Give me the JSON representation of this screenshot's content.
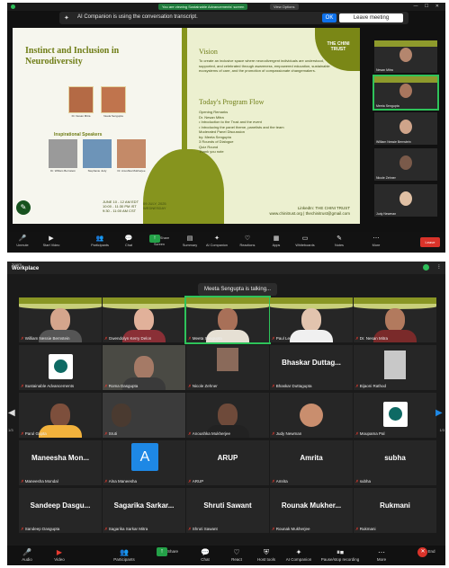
{
  "top": {
    "banner": "You are viewing Sustainable Advancements' screen",
    "view_options": "View Options",
    "ai_notice": "AI Companion is using the conversation transcript.",
    "ok": "OK",
    "leave_meeting": "Leave meeting",
    "slide": {
      "title_1": "Instinct and Inclusion in",
      "title_2": "Neurodiversity",
      "host1_cap": "Dr. Nesan Mitra",
      "host2_cap": "Neela Sengupta",
      "inspirational": "Inspirational Speakers",
      "sp1": "Dr. William Bernstein",
      "sp2": "Stephanie Judy",
      "sp3": "Dr. Anushka Mukherjee",
      "date_left": "JUNE 10 - 12 AM EDT\n10:00 - 11:30 PM IST\n9:30 - 11:00 AM CST",
      "date_right": "09 JULY, 2025\nWEDNESDAY",
      "logo": "THE CHINI TRUST",
      "vision_h": "Vision",
      "vision_p": "To create an inclusive space where neurodivergent individuals are understood, supported, and celebrated through awareness, empowered education, sustainable ecosystems of care, and the promotion of compassionate changemakers.",
      "flow_h": "Today's Program Flow",
      "flow_p": "Opening Remarks\nDr. Nesan Mitra\n• Introduction to the Trust and the event\n• Introducing the panel theme, panelists and the team\nModerated Panel Discussion\nby: Meeta Sengupta\n3 Rounds of Dialogue\nQuiz Round\nThank you note",
      "foot": "LinkedIn: THE CHINI TRUST\nwww.chinitrust.org | thechinitrust@gmail.com"
    },
    "strip": [
      {
        "name": "Nesan Mitra"
      },
      {
        "name": "Meeta Sengupta"
      },
      {
        "name": "William Nessie Bernstein"
      },
      {
        "name": "Nicole Zehner"
      },
      {
        "name": "Judy Newman"
      }
    ],
    "toolbar": [
      "Unmute",
      "Start Video",
      "Participants",
      "Chat",
      "Share Screen",
      "Summary",
      "AI Companion",
      "Reactions",
      "Apps",
      "Whiteboards",
      "Notes",
      "More"
    ],
    "leave": "Leave"
  },
  "bottom": {
    "brand_small": "zoom",
    "brand": "Workplace",
    "talking": "Meeta Sengupta is talking...",
    "page_prev": "1/3",
    "page_next": "1/3",
    "row1": [
      "William Nessie Bernstein",
      "Gwendolyn Kerry Delon",
      "Meeta Sengupta",
      "Paul Leary",
      "Dr. Nesan Mitra"
    ],
    "row2": [
      "Sustainable Advancements",
      "Roma Dasgupta",
      "Nicole Zehner",
      "Bhaskar Duttagupta",
      "Bijaoni Rathod"
    ],
    "row2_big": "Bhaskar Duttag...",
    "row3": [
      "Parul Gupta",
      "Sruti",
      "Anoushka Mukherjee",
      "Judy Newman",
      "Moupama Pal"
    ],
    "row4_big": [
      "Maneesha Mon...",
      "",
      "ARUP",
      "Amrita",
      "subha"
    ],
    "row4": [
      "Maneesha Mondal",
      "Alna Maneesha",
      "ARUP",
      "Amrita",
      "subha"
    ],
    "avatar_letter": "A",
    "row5_big": [
      "Sandeep Dasgu...",
      "Sagarika Sarkar...",
      "Shruti Sawant",
      "Rounak Mukher...",
      "Rukmani"
    ],
    "row5": [
      "Sandeep Dasgupta",
      "Sagarika Sarkar Mitra",
      "Shruti Sawant",
      "Rounak Mukherjee",
      "Rukmani"
    ],
    "toolbar": [
      "Audio",
      "Video",
      "Participants",
      "Share",
      "Chat",
      "React",
      "Host tools",
      "AI Companion",
      "Pause/stop recording",
      "More",
      "End"
    ]
  }
}
